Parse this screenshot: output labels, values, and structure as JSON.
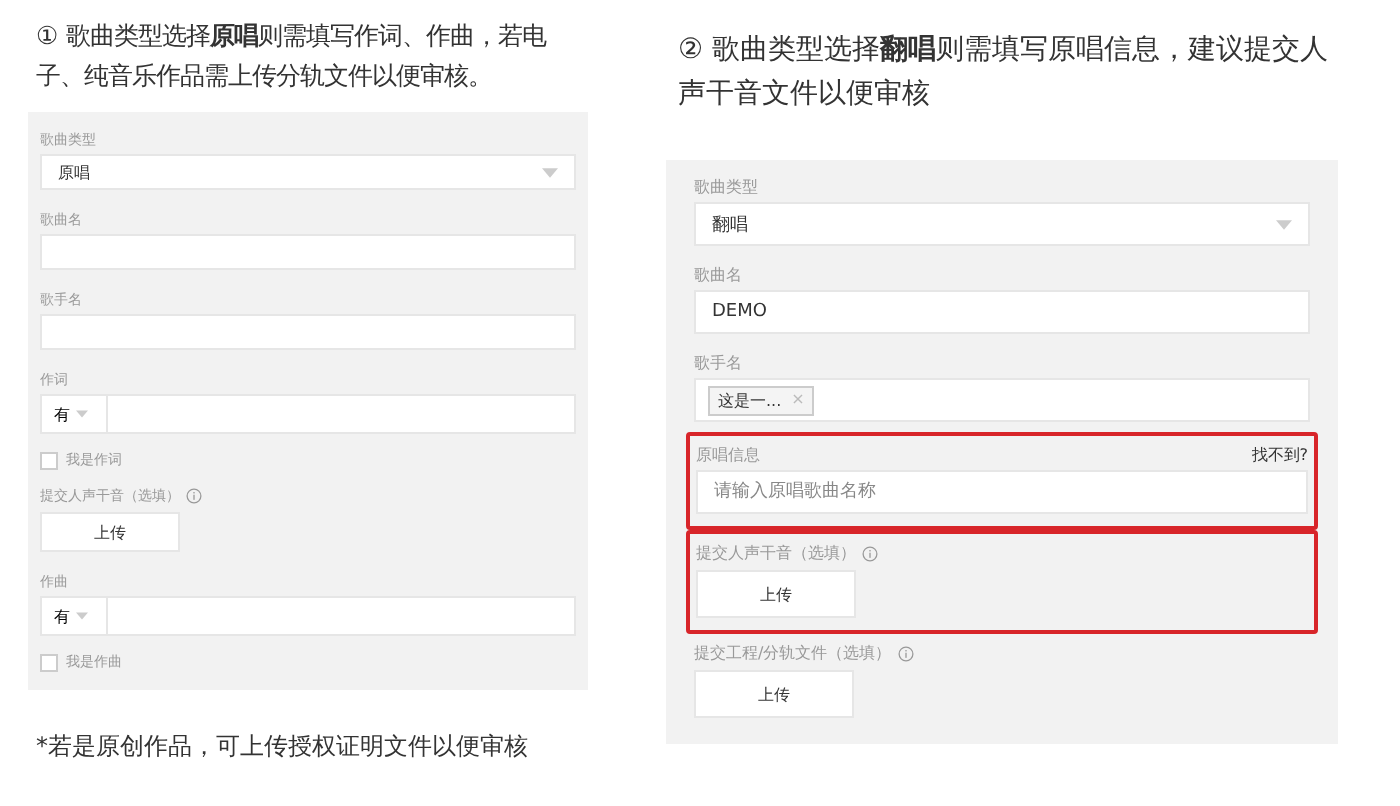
{
  "sections": [
    {
      "heading": "① 歌曲类型选择**原唱**则需填写作词、作曲，若电子、纯音乐作品需上传分轨文件以便审核。",
      "fields": [
        {
          "kind": "select",
          "label": "歌曲类型",
          "value": "原唱",
          "highlighted": false
        },
        {
          "kind": "text",
          "label": "歌曲名",
          "highlighted": false
        },
        {
          "kind": "text",
          "label": "歌手名",
          "highlighted": false
        },
        {
          "kind": "credit",
          "label": "作词",
          "prefix": "有",
          "highlighted": false
        },
        {
          "kind": "checkbox",
          "label": "我是作词",
          "checked": false,
          "highlighted": false
        },
        {
          "kind": "upload",
          "label": "提交人声干音（选填）",
          "button": "上传",
          "highlighted": false
        },
        {
          "kind": "credit",
          "label": "作曲",
          "prefix": "有",
          "highlighted": false
        },
        {
          "kind": "checkbox",
          "label": "我是作曲",
          "checked": false,
          "highlighted": false
        }
      ],
      "footnote": "*若是原创作品，可上传授权证明文件以便审核"
    },
    {
      "heading": "② 歌曲类型选择**翻唱**则需填写原唱信息，建议提交人声干音文件以便审核",
      "fields": [
        {
          "kind": "select",
          "label": "歌曲类型",
          "value": "翻唱",
          "highlighted": false
        },
        {
          "kind": "text",
          "label": "歌曲名",
          "value": "DEMO",
          "highlighted": false
        },
        {
          "kind": "tags",
          "label": "歌手名",
          "tags": [
            "这是一..."
          ],
          "remove_mark": "×",
          "highlighted": false
        },
        {
          "kind": "search",
          "label": "原唱信息",
          "link": "找不到?",
          "placeholder": "请输入原唱歌曲名称",
          "highlighted": true
        },
        {
          "kind": "upload",
          "label": "提交人声干音（选填）",
          "button": "上传",
          "highlighted": true
        },
        {
          "kind": "upload",
          "label": "提交工程/分轨文件（选填）",
          "button": "上传",
          "highlighted": false
        }
      ]
    }
  ]
}
